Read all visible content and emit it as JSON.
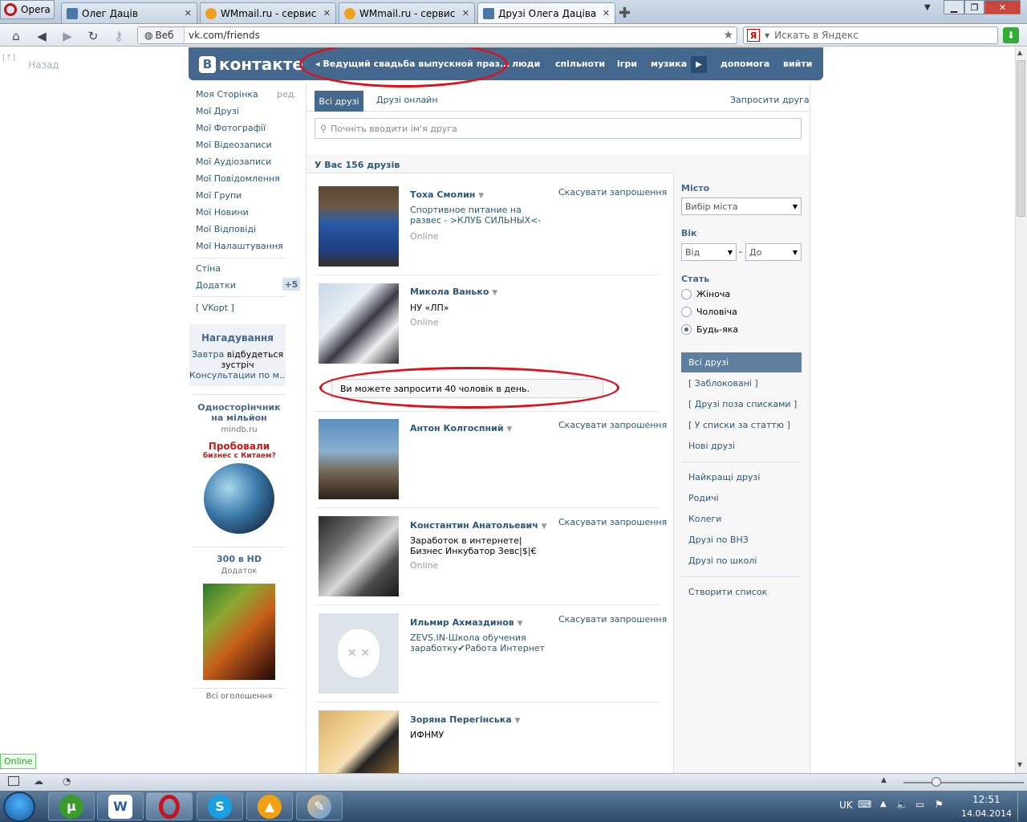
{
  "browser": {
    "menu_label": "Opera",
    "tabs": [
      {
        "title": "Олег Даців",
        "fav_color": "#4a76a8"
      },
      {
        "title": "WMmail.ru - сервис п...",
        "fav_color": "#f0a020"
      },
      {
        "title": "WMmail.ru - сервис п...",
        "fav_color": "#f0a020"
      },
      {
        "title": "Друзі Олега Даціва | 1...",
        "fav_color": "#4a76a8"
      }
    ],
    "web_label": "Веб",
    "url": "vk.com/friends",
    "search_placeholder": "Искать в Яндекс",
    "yandex_letter": "Я",
    "back_label": "Назад",
    "back_arrow": "[↑]"
  },
  "vk": {
    "logo_letter": "В",
    "logo_text": "контакте",
    "ad_text": "Ведущий свадьба выпускной праз...",
    "menu": [
      "люди",
      "спільноти",
      "ігри",
      "музика",
      "допомога",
      "вийти"
    ],
    "left_menu": [
      "Моя Сторінка",
      "Мої Друзі",
      "Мої Фотографії",
      "Мої Відеозаписи",
      "Мої Аудіозаписи",
      "Мої Повідомлення",
      "Мої Групи",
      "Мої Новини",
      "Мої Відповіді",
      "Мої Налаштування"
    ],
    "edit_label": "ред.",
    "wall": "Стіна",
    "apps": "Додатки",
    "apps_badge": "+5",
    "vkopt": "[ VKopt ]",
    "reminder": {
      "title": "Нагадування",
      "line1_link": "Завтра",
      "line1_rest": " відбудеться",
      "line2": "зустріч",
      "line3": "Консультации по м..."
    },
    "ad1": {
      "title": "Односторінчник на мільйон",
      "domain": "mindb.ru",
      "banner_l1": "Пробовали",
      "banner_l2": "бизнес с Китаем?"
    },
    "ad2": {
      "title": "300 в HD",
      "sub": "Додаток"
    },
    "all_ads": "Всі оголошення",
    "tabs": [
      "Всі друзі",
      "Друзі онлайн"
    ],
    "invite": "Запросити друга",
    "search_placeholder": "Почніть вводити ім'я друга",
    "count": "У Вас 156 друзів",
    "notice": "Ви можете запросити 40 чоловік в день.",
    "cancel_label": "Скасувати запрошення",
    "friends": [
      {
        "name": "Тоха Смолин",
        "sub": "Спортивное питание на развес - >КЛУБ СИЛЬНЫХ<-",
        "online": "Online",
        "cancel": true
      },
      {
        "name": "Микола Ванько",
        "sub": "НУ «ЛП»",
        "online": "Online",
        "cancel": false
      },
      {
        "name": "Антон Колгоспний",
        "sub": "",
        "online": "",
        "cancel": true
      },
      {
        "name": "Константин Анатольевич",
        "sub": "Заработок в интернете|Бизнес Инкубатор Зевс|$|€",
        "online": "Online",
        "cancel": true
      },
      {
        "name": "Ильмир Ахмaздинов",
        "sub": "ZEVS.IN-Школа обучения заработку✔Работа Интернет",
        "online": "",
        "cancel": true
      },
      {
        "name": "Зоряна Перегінська",
        "sub": "ИФНМУ",
        "online": "",
        "cancel": false
      }
    ],
    "filters": {
      "city_label": "Місто",
      "city_select": "Вибір міста",
      "age_label": "Вік",
      "age_from": "Від",
      "age_to": "До",
      "age_dash": "-",
      "sex_label": "Стать",
      "sex_options": [
        "Жіноча",
        "Чоловіча",
        "Будь-яка"
      ]
    },
    "lists": [
      "Всі друзі",
      "[ Заблоковані ]",
      "[ Друзі поза списками ]",
      "[ У списки за статтю ]",
      "Нові друзі",
      "Найкращі друзі",
      "Родичі",
      "Колеги",
      "Друзі по ВНЗ",
      "Друзі по школі",
      "Створити список"
    ]
  },
  "status": {
    "online_badge": "Online"
  },
  "taskbar": {
    "lang": "UK",
    "time": "12:51",
    "date": "14.04.2014"
  }
}
